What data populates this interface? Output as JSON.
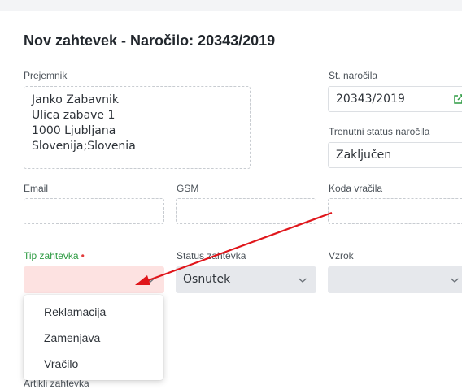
{
  "page": {
    "title": "Nov zahtevek - Naročilo: 20343/2019"
  },
  "recipient": {
    "label": "Prejemnik",
    "value": "Janko Zabavnik\nUlica zabave 1\n1000 Ljubljana\nSlovenija;Slovenia"
  },
  "order_number": {
    "label": "St. naročila",
    "value": "20343/2019",
    "icon": "external-link-icon"
  },
  "order_status": {
    "label": "Trenutni status naročila",
    "value": "Zaključen"
  },
  "email": {
    "label": "Email",
    "value": ""
  },
  "gsm": {
    "label": "GSM",
    "value": ""
  },
  "return_code": {
    "label": "Koda vračila",
    "value": ""
  },
  "request_type": {
    "label": "Tip zahtevka",
    "required_mark": "•",
    "value": "",
    "options": [
      "Reklamacija",
      "Zamenjava",
      "Vračilo"
    ]
  },
  "request_status": {
    "label": "Status zahtevka",
    "value": "Osnutek"
  },
  "reason": {
    "label": "Vzrok",
    "value": ""
  },
  "items_section": {
    "label": "Artikli zahtevka"
  },
  "colors": {
    "accent_green": "#2e9b43",
    "required_red": "#e23b3b",
    "annotation_arrow": "#e0161b",
    "error_bg": "#fde2e1",
    "select_bg": "#e6e8ec"
  }
}
